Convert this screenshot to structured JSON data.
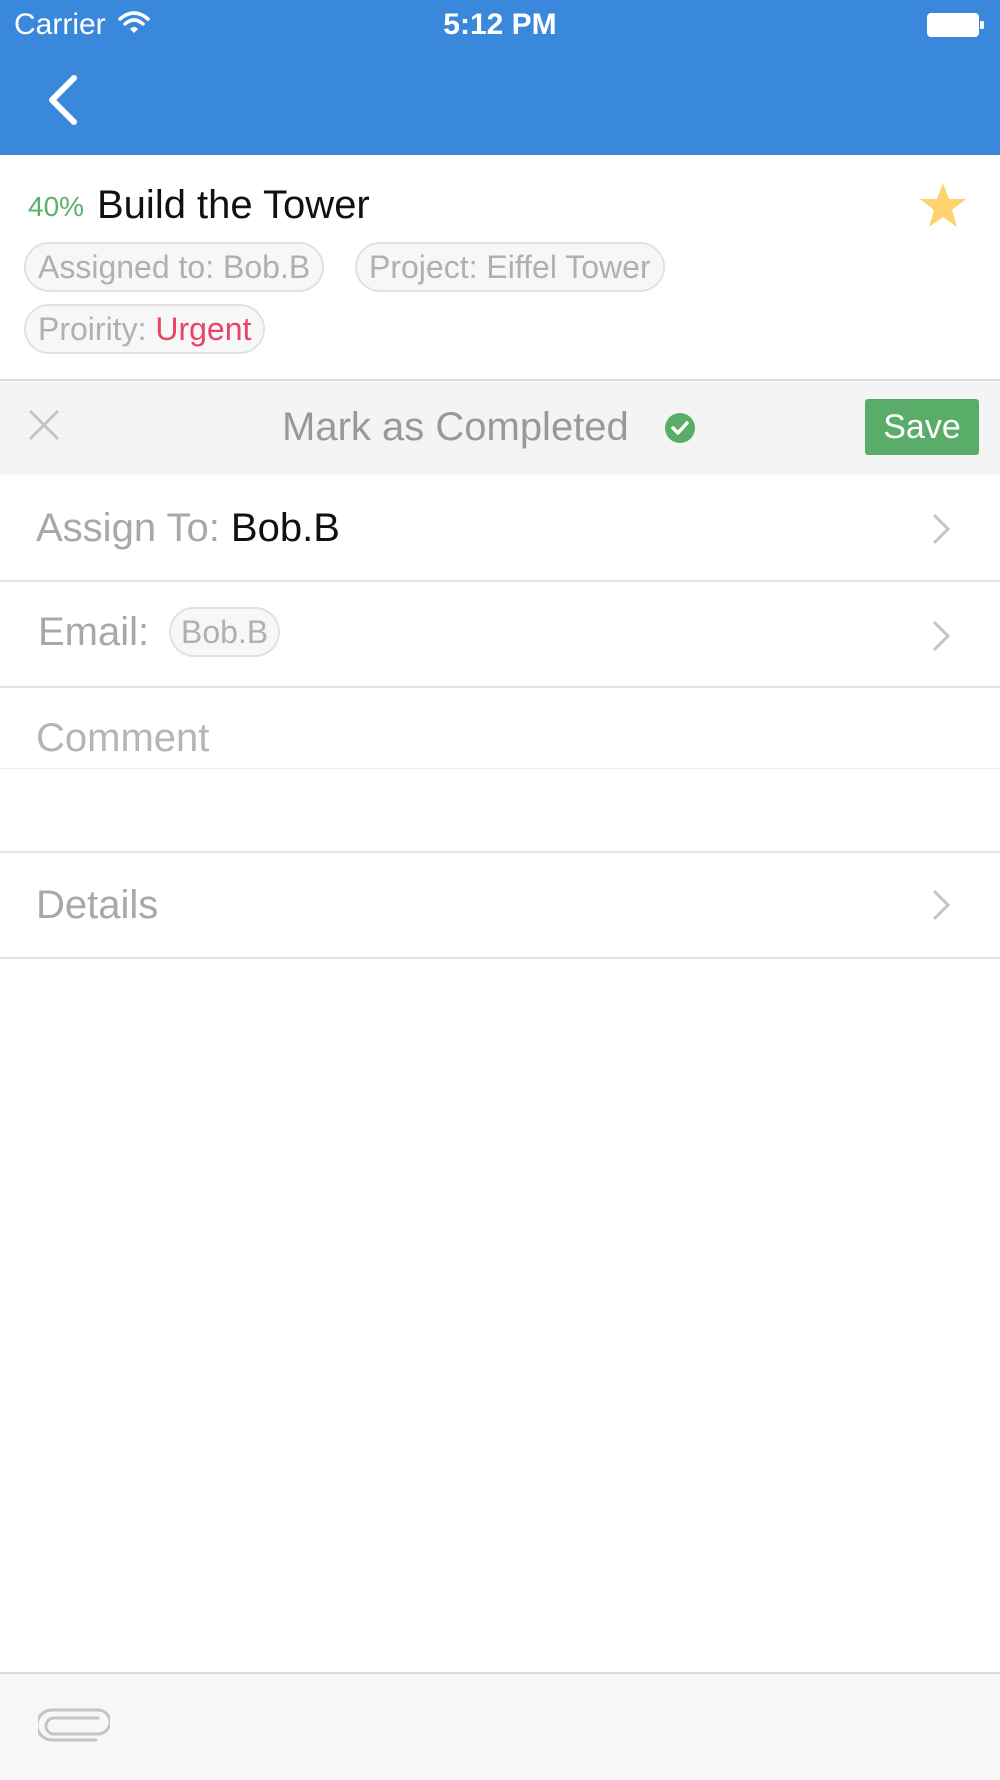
{
  "status_bar": {
    "carrier": "Carrier",
    "time": "5:12 PM"
  },
  "task": {
    "progress": "40%",
    "title": "Build the Tower",
    "starred": true,
    "assigned_label": "Assigned to: Bob.B",
    "project_label": "Project: Eiffel Tower",
    "priority_prefix": "Proirity: ",
    "priority_value": "Urgent"
  },
  "action_bar": {
    "mark_completed": "Mark as Completed",
    "save_label": "Save"
  },
  "form": {
    "assign_label": "Assign To: ",
    "assign_value": "Bob.B",
    "email_label": "Email:",
    "email_chip": "Bob.B",
    "comment_placeholder": "Comment",
    "details_label": "Details"
  },
  "colors": {
    "header": "#3a88db",
    "progress": "#5bb06a",
    "urgent": "#e9436a",
    "save": "#5aad69",
    "star": "#fdd36e"
  },
  "icons": {
    "back": "chevron-left-icon",
    "star": "star-icon",
    "close": "close-icon",
    "completed": "check-circle-icon",
    "chevron": "chevron-right-icon",
    "attach": "paperclip-icon"
  }
}
